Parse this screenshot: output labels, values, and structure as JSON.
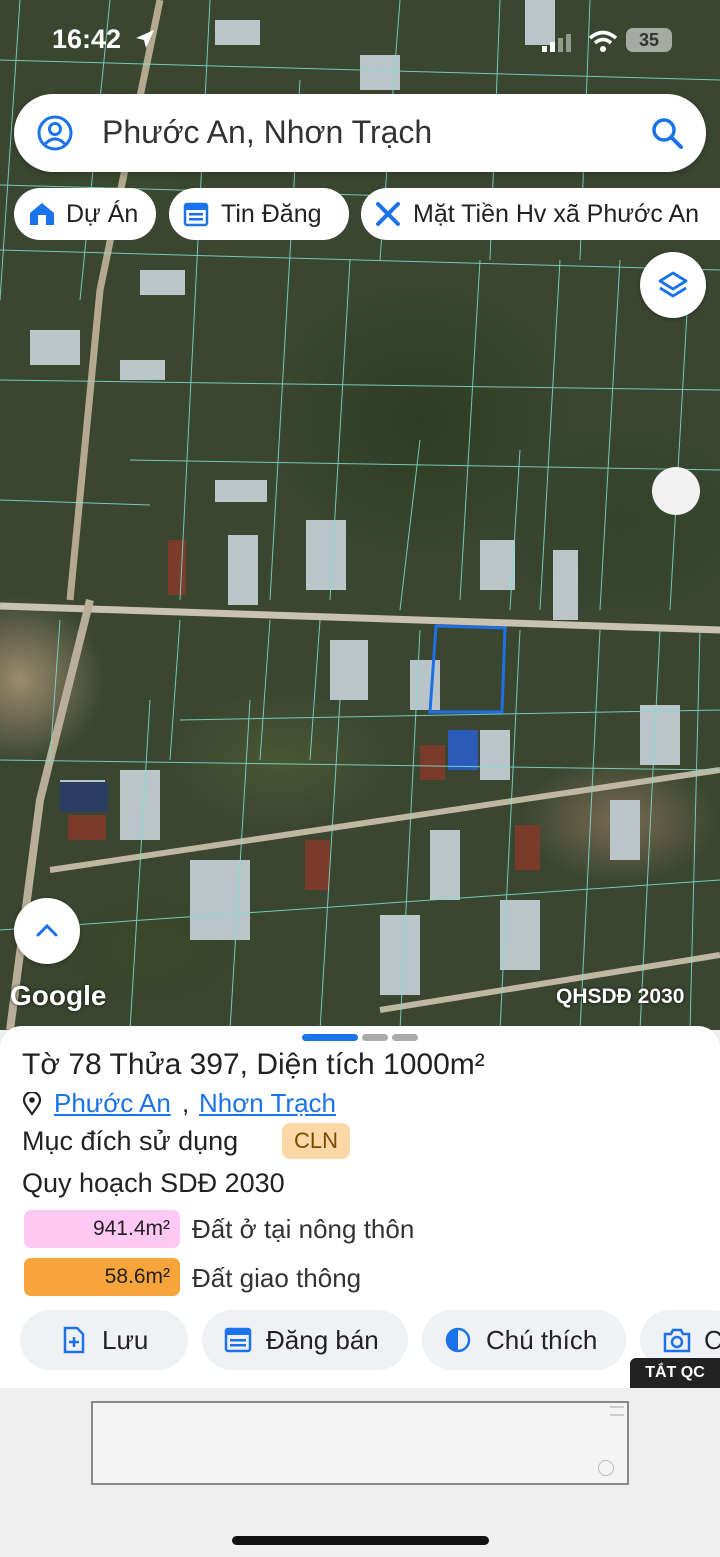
{
  "status_bar": {
    "time": "16:42",
    "battery": "35"
  },
  "search": {
    "query": "Phước An, Nhơn Trạch"
  },
  "chips": [
    {
      "label": "Dự Án",
      "icon": "house-icon"
    },
    {
      "label": "Tin Đăng",
      "icon": "calendar-icon"
    },
    {
      "label": "Mặt Tiền Hv xã Phước An",
      "icon": "cross-tools-icon"
    }
  ],
  "map": {
    "brand": "Google",
    "overlay_label": "QHSDĐ 2030"
  },
  "parcel": {
    "title": "Tờ 78 Thửa 397, Diện tích 1000m²",
    "ward": "Phước An",
    "separator": ",",
    "district": "Nhơn Trạch",
    "purpose_label": "Mục đích sử dụng",
    "purpose_code": "CLN",
    "plan_label": "Quy hoạch SDĐ 2030",
    "plan_items": [
      {
        "area": "941.4m²",
        "label": "Đất ở tại nông thôn",
        "color": "#ffc8f5"
      },
      {
        "area": "58.6m²",
        "label": "Đất giao thông",
        "color": "#f7a53a"
      }
    ]
  },
  "actions": [
    {
      "label": "Lưu",
      "icon": "file-plus-icon"
    },
    {
      "label": "Đăng bán",
      "icon": "calendar-icon"
    },
    {
      "label": "Chú thích",
      "icon": "half-circle-icon"
    },
    {
      "label": "C",
      "icon": "camera-icon"
    }
  ],
  "ad": {
    "close_label": "TẮT QC"
  },
  "colors": {
    "accent": "#1a73e8",
    "badge_bg": "#fbd8a5"
  }
}
